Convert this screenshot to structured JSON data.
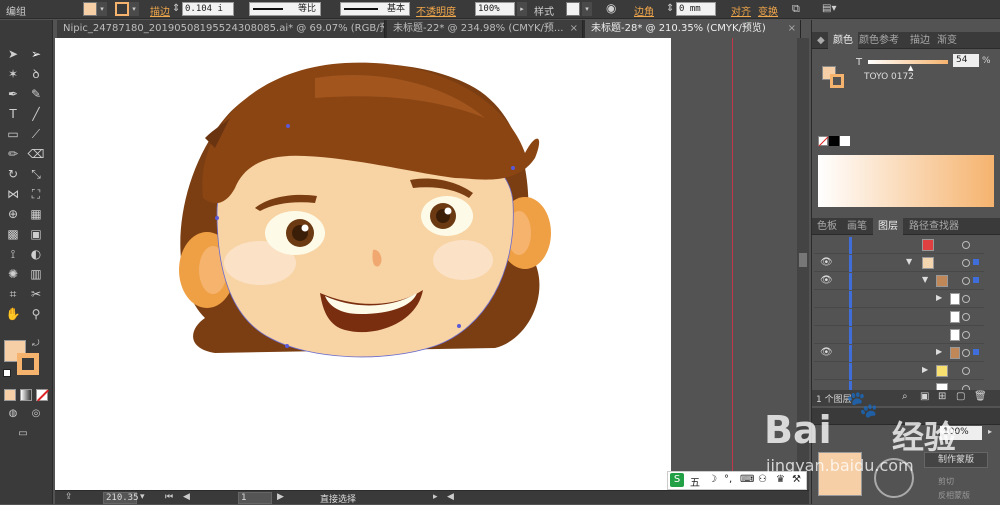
{
  "control_bar": {
    "mode_label": "编组",
    "stroke_label": "描边",
    "stroke_value": "0.104 i",
    "profile_label": "等比",
    "brush_label": "基本",
    "opacity_label": "不透明度",
    "opacity_value": "100%",
    "style_label": "样式",
    "corner_label": "边角",
    "corner_value": "0 mm",
    "align_label": "对齐",
    "transform_label": "变换"
  },
  "tabs": [
    {
      "label": "Nipic_24787180_20190508195524308085.ai* @ 69.07% (RGB/预..."
    },
    {
      "label": "未标题-22* @ 234.98% (CMYK/预..."
    },
    {
      "label": "未标题-28* @ 210.35% (CMYK/预览)"
    }
  ],
  "status_bar": {
    "zoom": "210.35",
    "page": "1",
    "status_text": "直接选择"
  },
  "color_panel": {
    "tabs": [
      "颜色",
      "颜色参考",
      "描边",
      "渐变"
    ],
    "channel_label": "T",
    "tint_value": "54",
    "tint_unit": "%",
    "swatch_name": "TOYO 0172",
    "swatch_color": "#f7c48a"
  },
  "layers_panel": {
    "tabs": [
      "色板",
      "画笔",
      "图层",
      "路径查找器"
    ],
    "layer_count": "1 个图层"
  },
  "transparency_panel": {
    "opacity_value": "100%",
    "make_mask_label": "制作蒙版",
    "clip_label": "剪切",
    "invert_label": "反相蒙版"
  },
  "ime": {
    "label": "五"
  },
  "watermark": {
    "text1": "Bai",
    "text2": "经验",
    "url": "jingyan.baidu.com"
  },
  "colors": {
    "fill": "#f7cfa6",
    "stroke": "#f5b36e",
    "accent": "#f0a64a"
  }
}
